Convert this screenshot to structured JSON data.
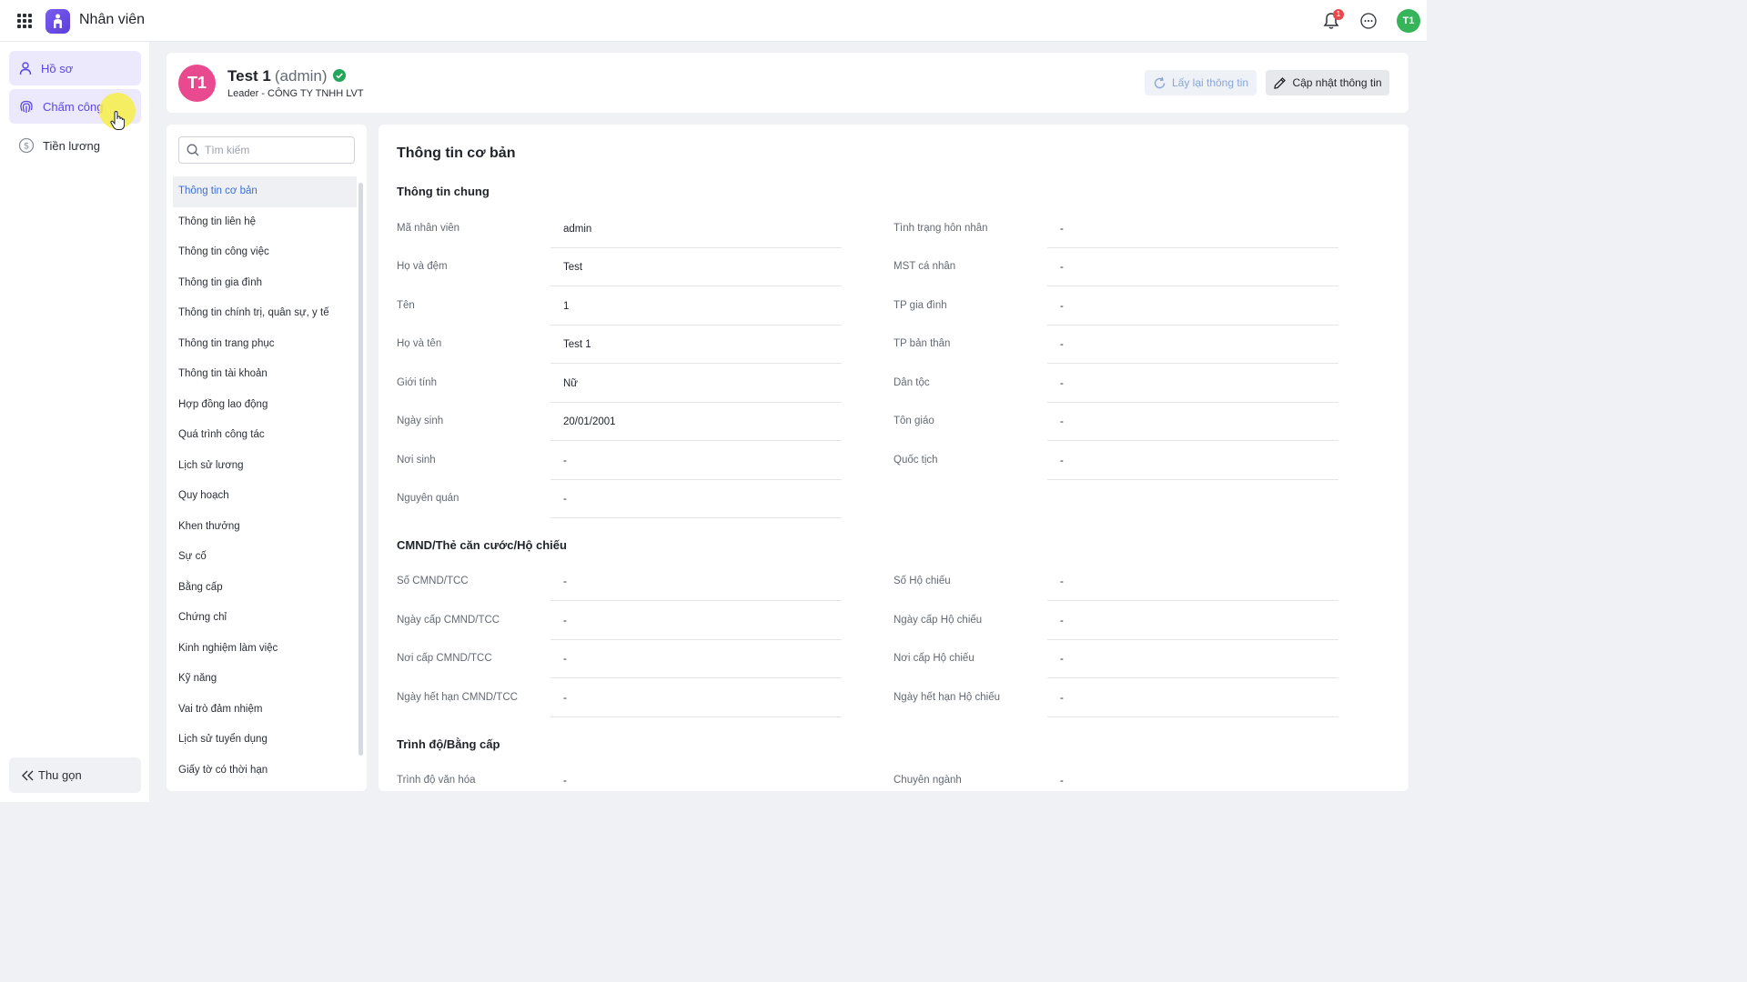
{
  "topbar": {
    "app_title": "Nhân viên",
    "notification_count": "1",
    "user_initials": "T1"
  },
  "sidebar": {
    "items": [
      {
        "label": "Hồ sơ",
        "icon": "user-icon"
      },
      {
        "label": "Chấm công",
        "icon": "fingerprint-icon"
      },
      {
        "label": "Tiền lương",
        "icon": "dollar-circle-icon"
      }
    ],
    "collapse_label": "Thu gọn"
  },
  "profile": {
    "initials": "T1",
    "name": "Test 1",
    "role": "(admin)",
    "subtitle": "Leader - CÔNG TY TNHH LVT",
    "reload_label": "Lấy lại thông tin",
    "update_label": "Cập nhật thông tin"
  },
  "nav": {
    "search_placeholder": "Tìm kiếm",
    "items": [
      "Thông tin cơ bản",
      "Thông tin liên hệ",
      "Thông tin công việc",
      "Thông tin gia đình",
      "Thông tin chính trị, quân sự, y tế",
      "Thông tin trang phục",
      "Thông tin tài khoản",
      "Hợp đồng lao động",
      "Quá trình công tác",
      "Lịch sử lương",
      "Quy hoạch",
      "Khen thưởng",
      "Sự cố",
      "Bằng cấp",
      "Chứng chỉ",
      "Kinh nghiệm làm việc",
      "Kỹ năng",
      "Vai trò đảm nhiệm",
      "Lịch sử tuyển dụng",
      "Giấy tờ có thời hạn"
    ]
  },
  "main": {
    "title": "Thông tin cơ bản",
    "general": {
      "title": "Thông tin chung",
      "left": [
        {
          "label": "Mã nhân viên",
          "value": "admin"
        },
        {
          "label": "Họ và đệm",
          "value": "Test"
        },
        {
          "label": "Tên",
          "value": "1"
        },
        {
          "label": "Họ và tên",
          "value": "Test 1"
        },
        {
          "label": "Giới tính",
          "value": "Nữ"
        },
        {
          "label": "Ngày sinh",
          "value": "20/01/2001"
        },
        {
          "label": "Nơi sinh",
          "value": "-"
        },
        {
          "label": "Nguyên quán",
          "value": "-"
        }
      ],
      "right": [
        {
          "label": "Tình trạng hôn nhân",
          "value": "-"
        },
        {
          "label": "MST cá nhân",
          "value": "-"
        },
        {
          "label": "TP gia đình",
          "value": "-"
        },
        {
          "label": "TP bản thân",
          "value": "-"
        },
        {
          "label": "Dân tộc",
          "value": "-"
        },
        {
          "label": "Tôn giáo",
          "value": "-"
        },
        {
          "label": "Quốc tịch",
          "value": "-"
        }
      ]
    },
    "identity": {
      "title": "CMND/Thẻ căn cước/Hộ chiếu",
      "left": [
        {
          "label": "Số CMND/TCC",
          "value": "-"
        },
        {
          "label": "Ngày cấp CMND/TCC",
          "value": "-"
        },
        {
          "label": "Nơi cấp CMND/TCC",
          "value": "-"
        },
        {
          "label": "Ngày hết hạn CMND/TCC",
          "value": "-"
        }
      ],
      "right": [
        {
          "label": "Số Hộ chiếu",
          "value": "-"
        },
        {
          "label": "Ngày cấp Hộ chiếu",
          "value": "-"
        },
        {
          "label": "Nơi cấp Hộ chiếu",
          "value": "-"
        },
        {
          "label": "Ngày hết hạn Hộ chiếu",
          "value": "-"
        }
      ]
    },
    "education": {
      "title": "Trình độ/Bằng cấp",
      "left": [
        {
          "label": "Trình độ văn hóa",
          "value": "-"
        }
      ],
      "right": [
        {
          "label": "Chuyên ngành",
          "value": "-"
        }
      ]
    }
  }
}
